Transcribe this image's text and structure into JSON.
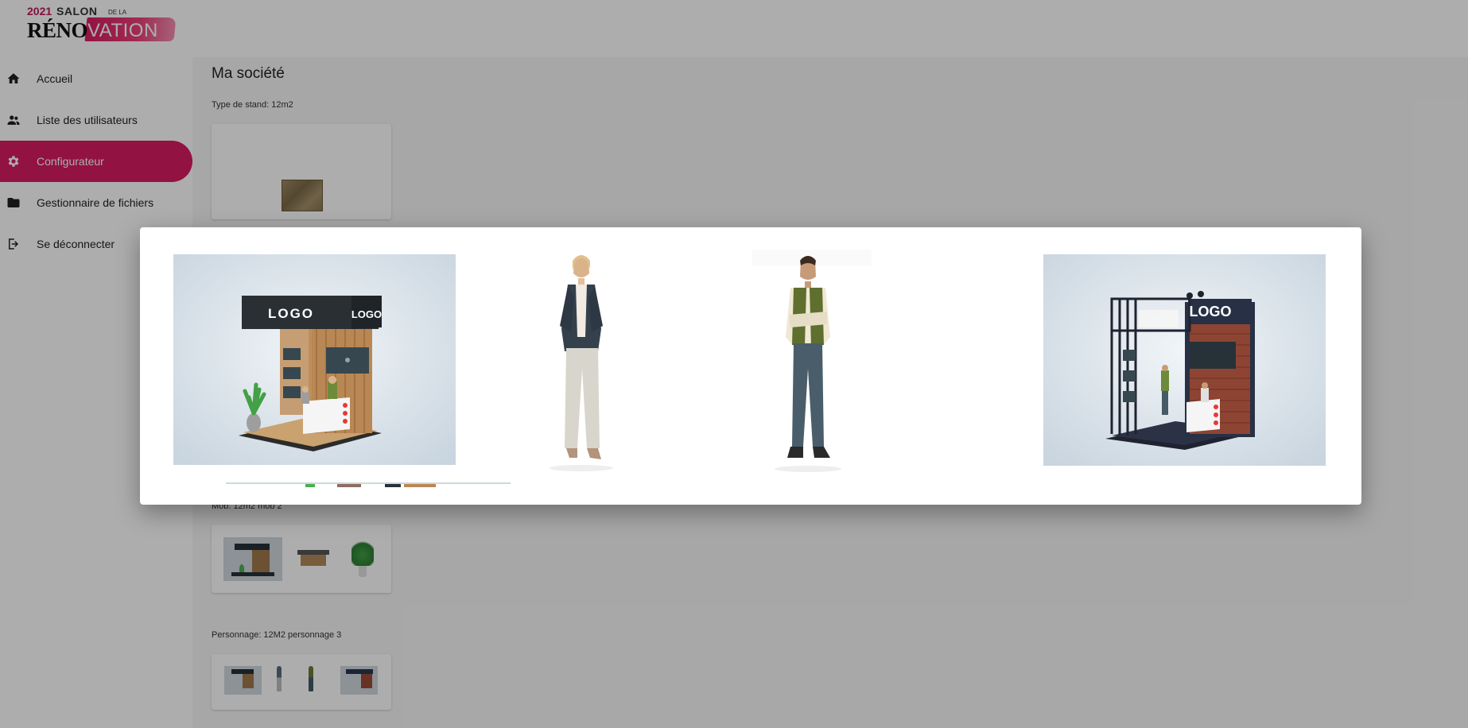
{
  "brand": {
    "year": "2021",
    "salon": "SALON",
    "de_la": "DE LA",
    "reno": "RÉNO",
    "vation": "VATION"
  },
  "sidebar": {
    "items": [
      {
        "label": "Accueil",
        "icon": "home-icon",
        "active": false
      },
      {
        "label": "Liste des utilisateurs",
        "icon": "people-icon",
        "active": false
      },
      {
        "label": "Configurateur",
        "icon": "gear-icon",
        "active": true
      },
      {
        "label": "Gestionnaire de fichiers",
        "icon": "folder-icon",
        "active": false
      },
      {
        "label": "Se déconnecter",
        "icon": "logout-icon",
        "active": false
      }
    ]
  },
  "main": {
    "title": "Ma société",
    "stand_type": "Type de stand: 12m2",
    "mob": "Mob: 12m2 mob 2",
    "personnage": "Personnage: 12M2 personnage 3"
  },
  "modal": {
    "images": [
      {
        "icon": "stand-wood-preview-image",
        "logo_text": "LOGO"
      },
      {
        "icon": "woman-character-image"
      },
      {
        "icon": "man-character-image"
      },
      {
        "icon": "stand-brick-preview-image",
        "logo_text": "LOGO"
      }
    ]
  },
  "colors": {
    "accent": "#d81b60",
    "backdrop": "rgba(0,0,0,0.32)",
    "sidebar_bg": "#ffffff",
    "main_bg": "#f7f7f7"
  }
}
